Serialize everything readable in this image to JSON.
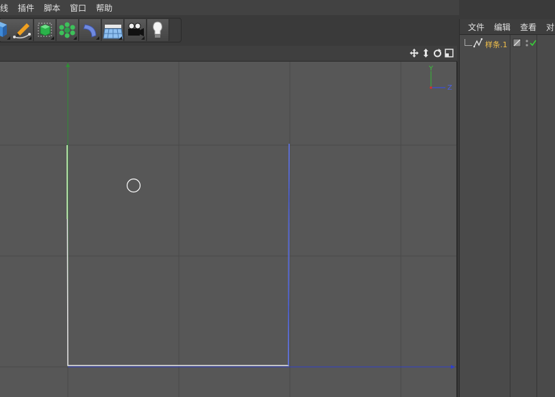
{
  "menubar": {
    "items": [
      "线",
      "插件",
      "脚本",
      "窗口",
      "帮助"
    ]
  },
  "toolbar": {
    "tools": [
      {
        "icon": "cube-icon"
      },
      {
        "icon": "pen-spline-icon"
      },
      {
        "icon": "subdivision-cube-icon"
      },
      {
        "icon": "array-cloner-icon"
      },
      {
        "icon": "deformer-bend-icon"
      },
      {
        "icon": "floor-plane-icon"
      },
      {
        "icon": "camera-icon"
      },
      {
        "icon": "light-bulb-icon"
      }
    ]
  },
  "viewport": {
    "nav_icons": [
      "move-view-icon",
      "zoom-view-icon",
      "rotate-view-icon",
      "maximize-view-icon"
    ],
    "axis_y": "Y",
    "axis_z": "Z",
    "colors": {
      "grid_bg": "#575757",
      "grid_line": "#4a4a4a",
      "axis_y": "#3aa83a",
      "axis_z": "#3b4fd8",
      "spline": "#e8e8e8"
    }
  },
  "object_manager": {
    "menu": [
      "文件",
      "编辑",
      "查看",
      "对"
    ],
    "objects": [
      {
        "name": "样条.1",
        "icon": "spline-object-icon"
      }
    ]
  }
}
